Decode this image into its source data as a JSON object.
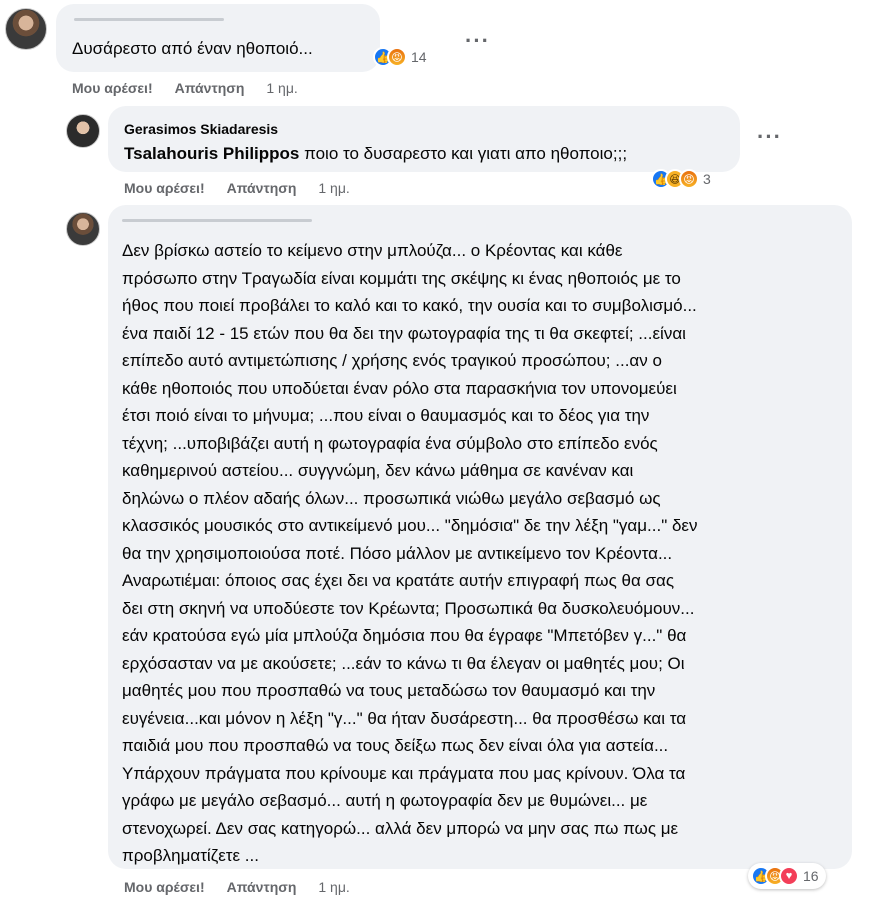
{
  "comments": [
    {
      "author": "",
      "text": "Δυσάρεστο από έναν ηθοποιό...",
      "reaction_count": "14",
      "actions": {
        "like": "Μου αρέσει!",
        "reply": "Απάντηση",
        "time": "1 ημ."
      }
    },
    {
      "author": "Gerasimos Skiadaresis",
      "mention": "Tsalahouris Philippos",
      "text": " ποιο το δυσαρεστο και γιατι απο ηθοποιο;;;",
      "reaction_count": "3",
      "actions": {
        "like": "Μου αρέσει!",
        "reply": "Απάντηση",
        "time": "1 ημ."
      }
    },
    {
      "author": "",
      "lines": [
        "Δεν βρίσκω αστείο το κείμενο στην μπλούζα... ο Κρέοντας και κάθε",
        "πρόσωπο στην Τραγωδία είναι κομμάτι της σκέψης κι ένας ηθοποιός με το",
        "ήθος που ποιεί προβάλει το καλό και το κακό, την ουσία και το συμβολισμό...",
        "ένα παιδί 12 - 15 ετών που θα δει την φωτογραφία της τι θα σκεφτεί; ...είναι",
        "επίπεδο αυτό αντιμετώπισης / χρήσης ενός τραγικού προσώπου; ...αν ο",
        "κάθε ηθοποιός που υποδύεται έναν ρόλο στα παρασκήνια τον υπονομεύει",
        "έτσι ποιό είναι το μήνυμα; ...που είναι ο θαυμασμός και το δέος για την",
        "τέχνη; ...υποβιβάζει αυτή η φωτογραφία ένα σύμβολο στο επίπεδο ενός",
        "καθημερινού αστείου... συγγνώμη, δεν κάνω μάθημα σε κανέναν και",
        "δηλώνω ο πλέον αδαής όλων... προσωπικά νιώθω μεγάλο σεβασμό ως",
        "κλασσικός μουσικός στο αντικείμενό μου... \"δημόσια\" δε την λέξη \"γαμ...\" δεν",
        "θα την χρησιμοποιούσα ποτέ. Πόσο μάλλον με αντικείμενο τον Κρέοντα...",
        "Αναρωτιέμαι: όποιος σας έχει δει να κρατάτε αυτήν επιγραφή πως θα σας",
        "δει στη σκηνή να υποδύεστε τον Κρέωντα; Προσωπικά θα δυσκολευόμουν...",
        "εάν κρατούσα εγώ μία μπλούζα δημόσια που θα έγραφε \"Μπετόβεν γ...\" θα",
        "ερχόσασταν να με ακούσετε; ...εάν το κάνω τι θα έλεγαν οι μαθητές μου; Οι",
        "μαθητές μου που προσπαθώ να τους μεταδώσω τον θαυμασμό και την",
        "ευγένεια...και μόνον η λέξη \"γ...\" θα ήταν δυσάρεστη... θα προσθέσω και τα",
        "παιδιά μου που προσπαθώ να τους δείξω πως δεν είναι όλα για αστεία...",
        "Υπάρχουν πράγματα που κρίνουμε και πράγματα που μας κρίνουν. Όλα τα",
        "γράφω με μεγάλο σεβασμό... αυτή η φωτογραφία δεν με θυμώνει... με",
        "στενοχωρεί. Δεν σας κατηγορώ... αλλά δεν μπορώ να μην σας πω πως με",
        "προβληματίζετε ..."
      ],
      "reaction_count": "16",
      "actions": {
        "like": "Μου αρέσει!",
        "reply": "Απάντηση",
        "time": "1 ημ."
      }
    }
  ],
  "icons": {
    "more": "more-options-icon",
    "reactions": [
      "like-reaction-icon",
      "angry-reaction-icon",
      "haha-reaction-icon",
      "love-reaction-icon"
    ]
  },
  "colors": {
    "bubble": "#f0f2f5",
    "meta_text": "#65676b",
    "like_blue": "#1877f2",
    "love_red": "#f33e58",
    "angry_orange": "#e9710f"
  }
}
